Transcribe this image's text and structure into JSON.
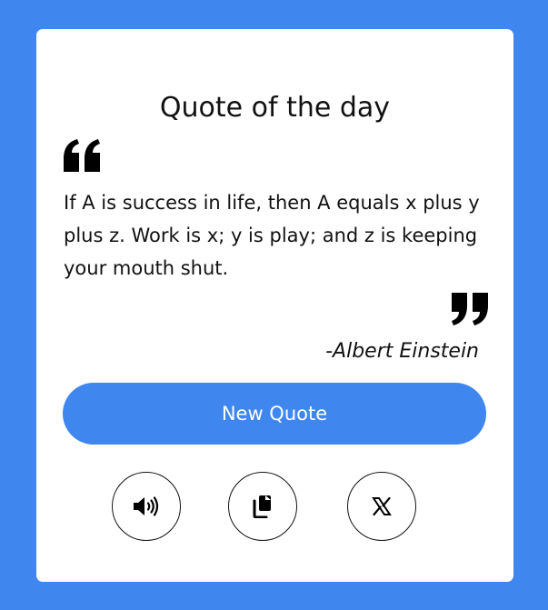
{
  "card": {
    "title": "Quote of the day",
    "quote": "If A is success in life, then A equals x plus y plus z. Work is x; y is play; and z is keeping your mouth shut.",
    "author": "-Albert Einstein"
  },
  "actions": {
    "new_quote_label": "New Quote",
    "speak_icon": "speaker-icon",
    "copy_icon": "copy-icon",
    "share_icon": "x-logo-icon"
  },
  "colors": {
    "background": "#3f87ef",
    "card": "#ffffff",
    "accent": "#3f87ef",
    "text": "#111111"
  }
}
